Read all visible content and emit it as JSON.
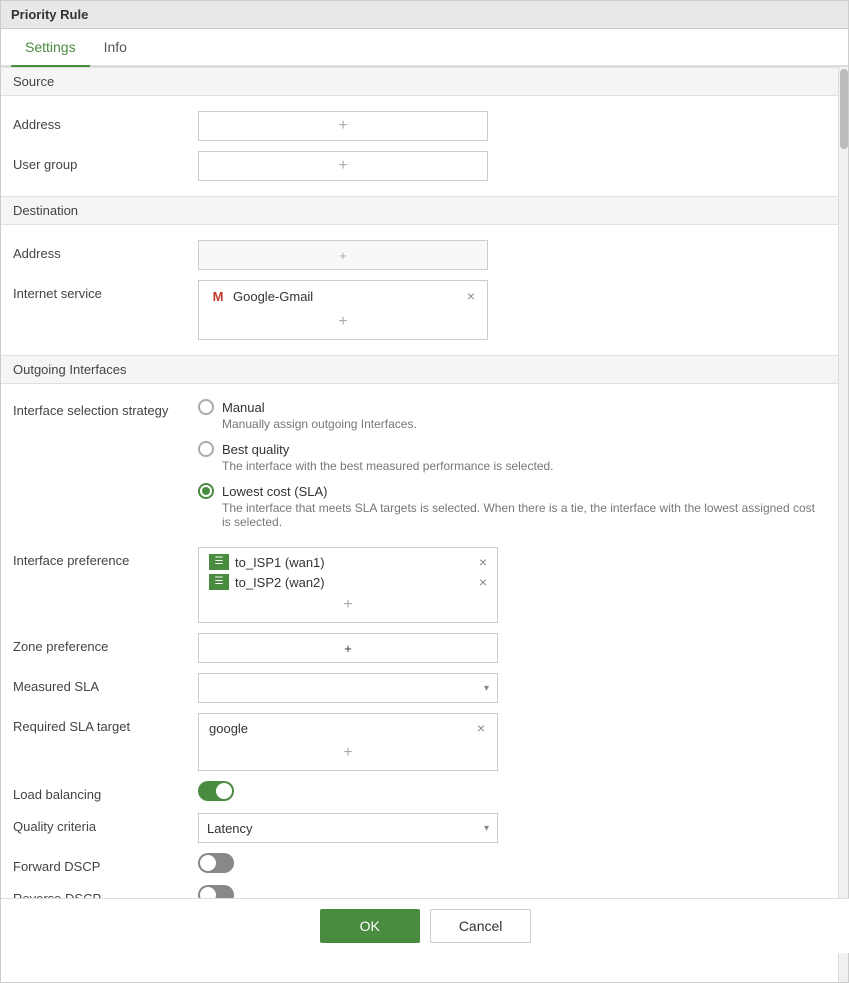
{
  "window": {
    "title": "Priority Rule"
  },
  "tabs": [
    {
      "label": "Settings",
      "active": true
    },
    {
      "label": "Info",
      "active": false
    }
  ],
  "sections": {
    "source": {
      "label": "Source",
      "address_label": "Address",
      "user_group_label": "User group"
    },
    "destination": {
      "label": "Destination",
      "address_label": "Address",
      "internet_service_label": "Internet service",
      "internet_service_value": "Google-Gmail"
    },
    "outgoing": {
      "label": "Outgoing Interfaces",
      "strategy_label": "Interface selection strategy",
      "strategies": [
        {
          "id": "manual",
          "label": "Manual",
          "description": "Manually assign outgoing Interfaces.",
          "checked": false
        },
        {
          "id": "best_quality",
          "label": "Best quality",
          "description": "The interface with the best measured performance is selected.",
          "checked": false
        },
        {
          "id": "lowest_cost",
          "label": "Lowest cost (SLA)",
          "description": "The interface that meets SLA targets is selected. When there is a tie, the interface with the lowest assigned cost is selected.",
          "checked": true
        }
      ],
      "interface_preference_label": "Interface preference",
      "interfaces": [
        {
          "label": "to_ISP1 (wan1)"
        },
        {
          "label": "to_ISP2 (wan2)"
        }
      ],
      "zone_preference_label": "Zone preference",
      "measured_sla_label": "Measured SLA",
      "required_sla_target_label": "Required SLA target",
      "required_sla_value": "google",
      "load_balancing_label": "Load balancing",
      "load_balancing_on": true,
      "quality_criteria_label": "Quality criteria",
      "quality_criteria_value": "Latency",
      "forward_dscp_label": "Forward DSCP",
      "forward_dscp_on": false,
      "reverse_dscp_label": "Reverse DSCP",
      "reverse_dscp_on": false
    }
  },
  "footer": {
    "ok_label": "OK",
    "cancel_label": "Cancel"
  },
  "icons": {
    "plus": "+",
    "close": "×",
    "chevron_down": "▾",
    "gmail": "M"
  }
}
